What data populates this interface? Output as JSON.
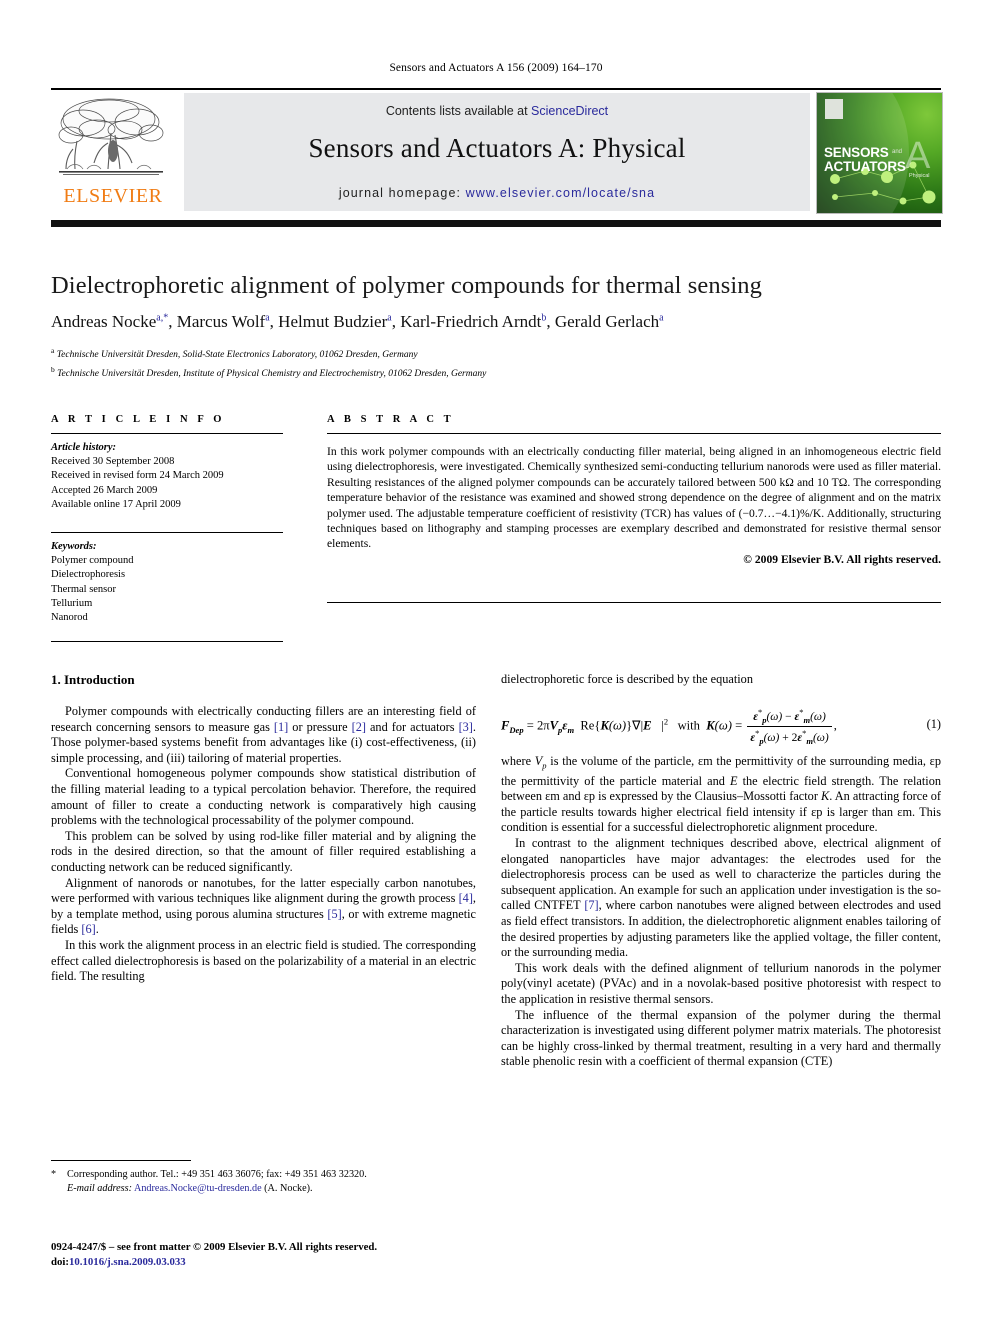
{
  "running_head": "Sensors and Actuators A 156 (2009) 164–170",
  "masthead": {
    "contents_prefix": "Contents lists available at ",
    "sciencedirect": "ScienceDirect",
    "journal_title": "Sensors and Actuators A: Physical",
    "homepage_label": "journal homepage:",
    "homepage_url": "www.elsevier.com/locate/sna",
    "publisher_logo_text": "ELSEVIER",
    "cover": {
      "line1": "SENSORS",
      "line2": "ACTUATORS",
      "and": "and",
      "letter": "A",
      "subtitle": "Physical"
    },
    "link_color": "#2a2a9c",
    "panel_color": "#e7e8ea",
    "elsevier_orange": "#f07c14"
  },
  "article": {
    "title": "Dielectrophoretic alignment of polymer compounds for thermal sensing",
    "authors_html": "Andreas Nocke<sup>a,*</sup>, Marcus Wolf<sup>a</sup>, Helmut Budzier<sup>a</sup>, Karl-Friedrich Arndt<sup>b</sup>, Gerald Gerlach<sup>a</sup>",
    "affiliations": [
      "Technische Universität Dresden, Solid-State Electronics Laboratory, 01062 Dresden, Germany",
      "Technische Universität Dresden, Institute of Physical Chemistry and Electrochemistry, 01062 Dresden, Germany"
    ],
    "affiliation_marks": [
      "a",
      "b"
    ]
  },
  "info": {
    "heading": "A R T I C L E   I N F O",
    "history_label": "Article history:",
    "history": [
      "Received 30 September 2008",
      "Received in revised form 24 March 2009",
      "Accepted 26 March 2009",
      "Available online 17 April 2009"
    ],
    "keywords_label": "Keywords:",
    "keywords": [
      "Polymer compound",
      "Dielectrophoresis",
      "Thermal sensor",
      "Tellurium",
      "Nanorod"
    ]
  },
  "abstract": {
    "heading": "A B S T R A C T",
    "text": "In this work polymer compounds with an electrically conducting filler material, being aligned in an inhomogeneous electric field using dielectrophoresis, were investigated. Chemically synthesized semi-conducting tellurium nanorods were used as filler material. Resulting resistances of the aligned polymer compounds can be accurately tailored between 500 kΩ and 10 TΩ. The corresponding temperature behavior of the resistance was examined and showed strong dependence on the degree of alignment and on the matrix polymer used. The adjustable temperature coefficient of resistivity (TCR) has values of (−0.7…−4.1)%/K. Additionally, structuring techniques based on lithography and stamping processes are exemplary described and demonstrated for resistive thermal sensor elements.",
    "copyright": "© 2009 Elsevier B.V. All rights reserved."
  },
  "body": {
    "section_number_title": "1. Introduction",
    "left_paragraphs": [
      "Polymer compounds with electrically conducting fillers are an interesting field of research concerning sensors to measure gas [1] or pressure [2] and for actuators [3]. Those polymer-based systems benefit from advantages like (i) cost-effectiveness, (ii) simple processing, and (iii) tailoring of material properties.",
      "Conventional homogeneous polymer compounds show statistical distribution of the filling material leading to a typical percolation behavior. Therefore, the required amount of filler to create a conducting network is comparatively high causing problems with the technological processability of the polymer compound.",
      "This problem can be solved by using rod-like filler material and by aligning the rods in the desired direction, so that the amount of filler required establishing a conducting network can be reduced significantly.",
      "Alignment of nanorods or nanotubes, for the latter especially carbon nanotubes, were performed with various techniques like alignment during the growth process [4], by a template method, using porous alumina structures [5], or with extreme magnetic fields [6].",
      "In this work the alignment process in an electric field is studied. The corresponding effect called dielectrophoresis is based on the polarizability of a material in an electric field. The resulting"
    ],
    "right_lead": "dielectrophoretic force is described by the equation",
    "equation": {
      "number": "(1)",
      "lhs": "F",
      "lhs_sub": "Dep",
      "rhs_prefix": "= 2πV",
      "rhs_sub_p": "p",
      "eps_m": "ε",
      "eps_m_sub": "m",
      "re_part": "Re{K(ω)}∇|E|",
      "re_exp": "2",
      "with": "with",
      "kw": "K(ω) =",
      "numerator": "ε*p(ω) − ε*m(ω)",
      "denominator": "ε*p(ω) + 2ε*m(ω)",
      "trailing_comma": ","
    },
    "right_paragraphs": [
      "where Vp is the volume of the particle, εm the permittivity of the surrounding media, εp the permittivity of the particle material and E the electric field strength. The relation between εm and εp is expressed by the Clausius–Mossotti factor K. An attracting force of the particle results towards higher electrical field intensity if εp is larger than εm. This condition is essential for a successful dielectrophoretic alignment procedure.",
      "In contrast to the alignment techniques described above, electrical alignment of elongated nanoparticles have major advantages: the electrodes used for the dielectrophoresis process can be used as well to characterize the particles during the subsequent application. An example for such an application under investigation is the so-called CNTFET [7], where carbon nanotubes were aligned between electrodes and used as field effect transistors. In addition, the dielectrophoretic alignment enables tailoring of the desired properties by adjusting parameters like the applied voltage, the filler content, or the surrounding media.",
      "This work deals with the defined alignment of tellurium nanorods in the polymer poly(vinyl acetate) (PVAc) and in a novolak-based positive photoresist with respect to the application in resistive thermal sensors.",
      "The influence of the thermal expansion of the polymer during the thermal characterization is investigated using different polymer matrix materials. The photoresist can be highly cross-linked by thermal treatment, resulting in a very hard and thermally stable phenolic resin with a coefficient of thermal expansion (CTE)"
    ]
  },
  "footer": {
    "star": "*",
    "corresponding": "Corresponding author. Tel.: +49 351 463 36076; fax: +49 351 463 32320.",
    "email_label": "E-mail address:",
    "email": "Andreas.Nocke@tu-dresden.de",
    "email_suffix": "(A. Nocke).",
    "imprint": "0924-4247/$ – see front matter © 2009 Elsevier B.V. All rights reserved.",
    "doi_label": "doi:",
    "doi": "10.1016/j.sna.2009.03.033"
  }
}
